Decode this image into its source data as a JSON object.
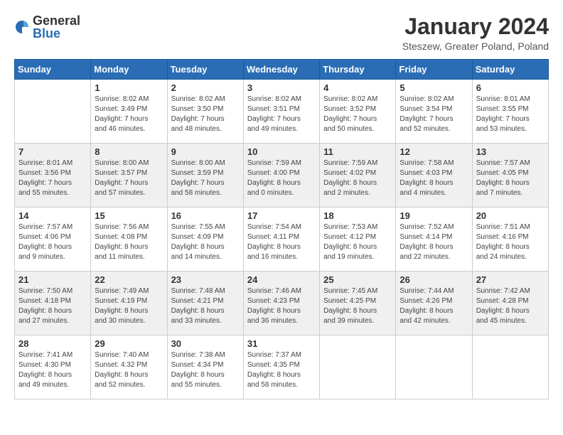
{
  "logo": {
    "general": "General",
    "blue": "Blue"
  },
  "title": "January 2024",
  "subtitle": "Steszew, Greater Poland, Poland",
  "days_of_week": [
    "Sunday",
    "Monday",
    "Tuesday",
    "Wednesday",
    "Thursday",
    "Friday",
    "Saturday"
  ],
  "weeks": [
    [
      {
        "day": "",
        "info": ""
      },
      {
        "day": "1",
        "info": "Sunrise: 8:02 AM\nSunset: 3:49 PM\nDaylight: 7 hours\nand 46 minutes."
      },
      {
        "day": "2",
        "info": "Sunrise: 8:02 AM\nSunset: 3:50 PM\nDaylight: 7 hours\nand 48 minutes."
      },
      {
        "day": "3",
        "info": "Sunrise: 8:02 AM\nSunset: 3:51 PM\nDaylight: 7 hours\nand 49 minutes."
      },
      {
        "day": "4",
        "info": "Sunrise: 8:02 AM\nSunset: 3:52 PM\nDaylight: 7 hours\nand 50 minutes."
      },
      {
        "day": "5",
        "info": "Sunrise: 8:02 AM\nSunset: 3:54 PM\nDaylight: 7 hours\nand 52 minutes."
      },
      {
        "day": "6",
        "info": "Sunrise: 8:01 AM\nSunset: 3:55 PM\nDaylight: 7 hours\nand 53 minutes."
      }
    ],
    [
      {
        "day": "7",
        "info": "Sunrise: 8:01 AM\nSunset: 3:56 PM\nDaylight: 7 hours\nand 55 minutes."
      },
      {
        "day": "8",
        "info": "Sunrise: 8:00 AM\nSunset: 3:57 PM\nDaylight: 7 hours\nand 57 minutes."
      },
      {
        "day": "9",
        "info": "Sunrise: 8:00 AM\nSunset: 3:59 PM\nDaylight: 7 hours\nand 58 minutes."
      },
      {
        "day": "10",
        "info": "Sunrise: 7:59 AM\nSunset: 4:00 PM\nDaylight: 8 hours\nand 0 minutes."
      },
      {
        "day": "11",
        "info": "Sunrise: 7:59 AM\nSunset: 4:02 PM\nDaylight: 8 hours\nand 2 minutes."
      },
      {
        "day": "12",
        "info": "Sunrise: 7:58 AM\nSunset: 4:03 PM\nDaylight: 8 hours\nand 4 minutes."
      },
      {
        "day": "13",
        "info": "Sunrise: 7:57 AM\nSunset: 4:05 PM\nDaylight: 8 hours\nand 7 minutes."
      }
    ],
    [
      {
        "day": "14",
        "info": "Sunrise: 7:57 AM\nSunset: 4:06 PM\nDaylight: 8 hours\nand 9 minutes."
      },
      {
        "day": "15",
        "info": "Sunrise: 7:56 AM\nSunset: 4:08 PM\nDaylight: 8 hours\nand 11 minutes."
      },
      {
        "day": "16",
        "info": "Sunrise: 7:55 AM\nSunset: 4:09 PM\nDaylight: 8 hours\nand 14 minutes."
      },
      {
        "day": "17",
        "info": "Sunrise: 7:54 AM\nSunset: 4:11 PM\nDaylight: 8 hours\nand 16 minutes."
      },
      {
        "day": "18",
        "info": "Sunrise: 7:53 AM\nSunset: 4:12 PM\nDaylight: 8 hours\nand 19 minutes."
      },
      {
        "day": "19",
        "info": "Sunrise: 7:52 AM\nSunset: 4:14 PM\nDaylight: 8 hours\nand 22 minutes."
      },
      {
        "day": "20",
        "info": "Sunrise: 7:51 AM\nSunset: 4:16 PM\nDaylight: 8 hours\nand 24 minutes."
      }
    ],
    [
      {
        "day": "21",
        "info": "Sunrise: 7:50 AM\nSunset: 4:18 PM\nDaylight: 8 hours\nand 27 minutes."
      },
      {
        "day": "22",
        "info": "Sunrise: 7:49 AM\nSunset: 4:19 PM\nDaylight: 8 hours\nand 30 minutes."
      },
      {
        "day": "23",
        "info": "Sunrise: 7:48 AM\nSunset: 4:21 PM\nDaylight: 8 hours\nand 33 minutes."
      },
      {
        "day": "24",
        "info": "Sunrise: 7:46 AM\nSunset: 4:23 PM\nDaylight: 8 hours\nand 36 minutes."
      },
      {
        "day": "25",
        "info": "Sunrise: 7:45 AM\nSunset: 4:25 PM\nDaylight: 8 hours\nand 39 minutes."
      },
      {
        "day": "26",
        "info": "Sunrise: 7:44 AM\nSunset: 4:26 PM\nDaylight: 8 hours\nand 42 minutes."
      },
      {
        "day": "27",
        "info": "Sunrise: 7:42 AM\nSunset: 4:28 PM\nDaylight: 8 hours\nand 45 minutes."
      }
    ],
    [
      {
        "day": "28",
        "info": "Sunrise: 7:41 AM\nSunset: 4:30 PM\nDaylight: 8 hours\nand 49 minutes."
      },
      {
        "day": "29",
        "info": "Sunrise: 7:40 AM\nSunset: 4:32 PM\nDaylight: 8 hours\nand 52 minutes."
      },
      {
        "day": "30",
        "info": "Sunrise: 7:38 AM\nSunset: 4:34 PM\nDaylight: 8 hours\nand 55 minutes."
      },
      {
        "day": "31",
        "info": "Sunrise: 7:37 AM\nSunset: 4:35 PM\nDaylight: 8 hours\nand 58 minutes."
      },
      {
        "day": "",
        "info": ""
      },
      {
        "day": "",
        "info": ""
      },
      {
        "day": "",
        "info": ""
      }
    ]
  ]
}
